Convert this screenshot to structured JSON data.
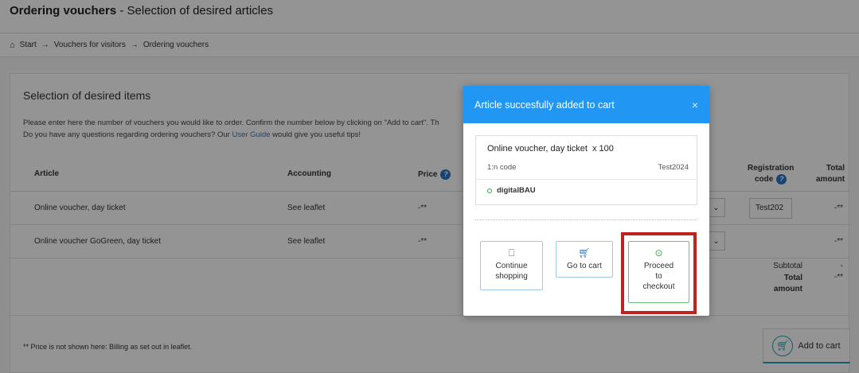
{
  "header": {
    "title_bold": "Ordering vouchers",
    "title_rest": " - Selection of desired articles"
  },
  "breadcrumb": {
    "items": [
      "Start",
      "Vouchers for visitors",
      "Ordering vouchers"
    ],
    "separator": "→"
  },
  "panel": {
    "heading": "Selection of desired items",
    "intro_line1": "Please enter here the number of vouchers you would like to order. Confirm the number below by clicking on \"Add to cart\". Th",
    "intro_line2_pre": "Do you have any questions regarding ordering vouchers? Our ",
    "intro_link": "User Guide",
    "intro_line2_post": " would give you useful tips!"
  },
  "table": {
    "columns": {
      "article": "Article",
      "accounting": "Accounting",
      "price": "Price",
      "registration_code_1": "Registration",
      "registration_code_2": "code",
      "total_1": "Total",
      "total_2": "amount"
    },
    "rows": [
      {
        "article": "Online voucher, day ticket",
        "accounting": "See leaflet",
        "price": "-**",
        "code": "Test202",
        "total": "-**"
      },
      {
        "article": "Online voucher GoGreen, day ticket",
        "accounting": "See leaflet",
        "price": "-**",
        "code": "",
        "total": "-**"
      }
    ],
    "subtotal_label": "Subtotal",
    "subtotal_value": "-",
    "total_label_1": "Total",
    "total_label_2": "amount",
    "total_value": "-**"
  },
  "footer": {
    "footnote": "** Price is not shown here: Billing as set out in leaflet.",
    "add_to_cart": "Add to cart"
  },
  "modal": {
    "title": "Article succesfully added to cart",
    "close": "×",
    "item_name": "Online voucher, day ticket",
    "item_qty": "x 100",
    "code_type": "1:n code",
    "code_value": "Test2024",
    "provider": "digitalBAU",
    "btn_continue_1": "Continue",
    "btn_continue_2": "shopping",
    "btn_gocart": "Go to cart",
    "btn_checkout_1": "Proceed",
    "btn_checkout_2": "to",
    "btn_checkout_3": "checkout"
  },
  "icons": {
    "home": "home-icon",
    "help": "help-icon",
    "bag": "shopping-bag-icon",
    "cart": "cart-icon",
    "arrow": "arrow-circle-right-icon"
  },
  "colors": {
    "modal_header": "#2196f3",
    "highlight": "#c0221e",
    "accent": "#27a0b8"
  }
}
